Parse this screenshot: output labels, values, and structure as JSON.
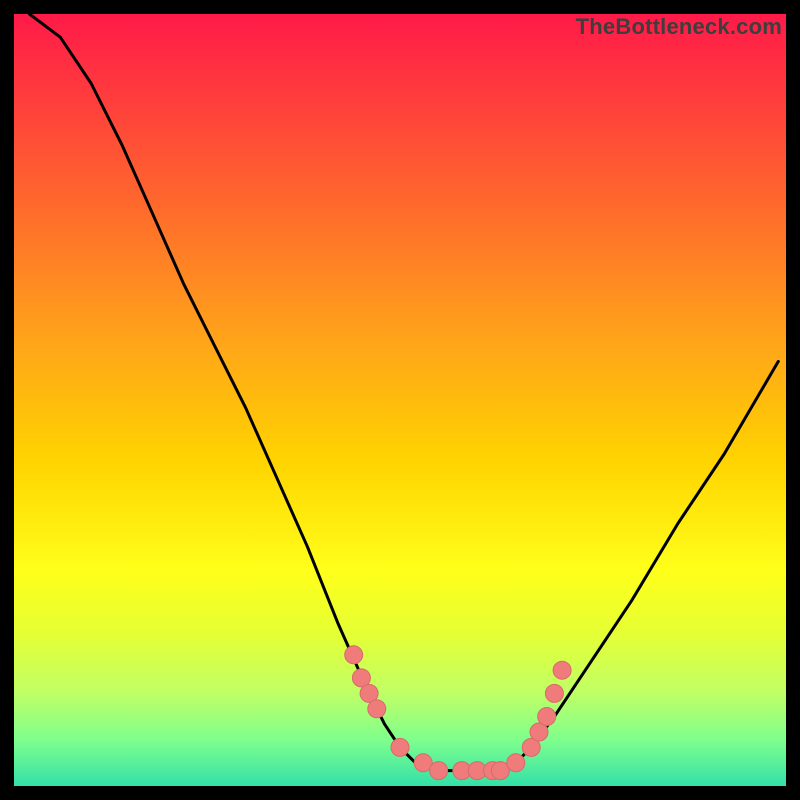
{
  "watermark": "TheBottleneck.com",
  "chart_data": {
    "type": "line",
    "title": "",
    "xlabel": "",
    "ylabel": "",
    "xlim": [
      0,
      100
    ],
    "ylim": [
      0,
      100
    ],
    "series": [
      {
        "name": "curve",
        "x": [
          2,
          6,
          10,
          14,
          18,
          22,
          26,
          30,
          34,
          38,
          42,
          46,
          48,
          50,
          52,
          55,
          58,
          60,
          63,
          65,
          67,
          70,
          74,
          80,
          86,
          92,
          99
        ],
        "y": [
          100,
          97,
          91,
          83,
          74,
          65,
          57,
          49,
          40,
          31,
          21,
          12,
          8,
          5,
          3,
          2,
          2,
          2,
          2,
          3,
          5,
          9,
          15,
          24,
          34,
          43,
          55
        ]
      }
    ],
    "markers": {
      "name": "highlighted-points",
      "color": "#f08080",
      "x": [
        44,
        45,
        46,
        47,
        50,
        53,
        55,
        58,
        60,
        62,
        63,
        65,
        67,
        68,
        69,
        70,
        71
      ],
      "y": [
        17,
        14,
        12,
        10,
        5,
        3,
        2,
        2,
        2,
        2,
        2,
        3,
        5,
        7,
        9,
        12,
        15
      ]
    }
  },
  "colors": {
    "marker": "#ef7b7b",
    "curve": "#000000"
  }
}
